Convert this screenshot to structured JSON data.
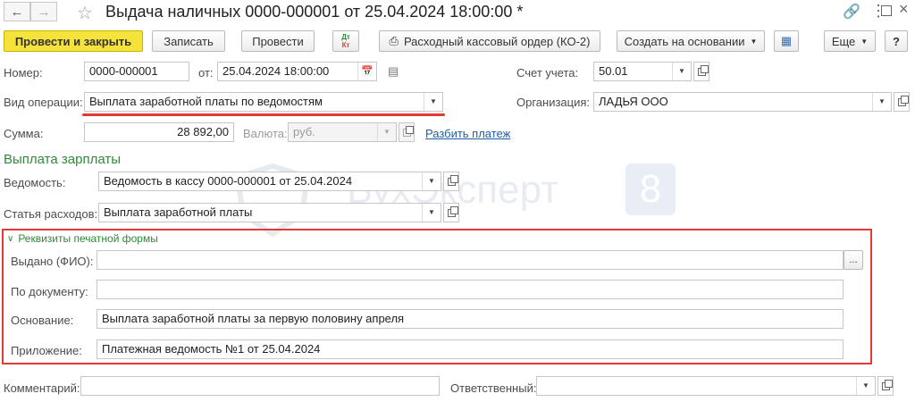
{
  "window": {
    "title": "Выдача наличных 0000-000001 от 25.04.2024 18:00:00 *"
  },
  "toolbar": {
    "post_close": "Провести и закрыть",
    "save": "Записать",
    "post": "Провести",
    "dtkt_top": "Дт",
    "dtkt_bottom": "Кт",
    "print_order": "Расходный кассовый ордер (КО-2)",
    "create_based": "Создать на основании",
    "more": "Еще",
    "help": "?"
  },
  "header": {
    "number_label": "Номер:",
    "number": "0000-000001",
    "date_label": "от:",
    "date": "25.04.2024 18:00:00",
    "account_label": "Счет учета:",
    "account": "50.01",
    "operation_label": "Вид операции:",
    "operation": "Выплата заработной платы по ведомостям",
    "org_label": "Организация:",
    "org": "ЛАДЬЯ ООО",
    "sum_label": "Сумма:",
    "sum": "28 892,00",
    "currency_label": "Валюта:",
    "currency": "руб.",
    "split_link": "Разбить платеж"
  },
  "salary": {
    "title": "Выплата зарплаты",
    "statement_label": "Ведомость:",
    "statement": "Ведомость в кассу 0000-000001 от 25.04.2024",
    "expense_label": "Статья расходов:",
    "expense": "Выплата заработной платы"
  },
  "print_form": {
    "title": "Реквизиты печатной формы",
    "issued_label": "Выдано (ФИО):",
    "issued": "",
    "doc_label": "По документу:",
    "doc": "",
    "basis_label": "Основание:",
    "basis": "Выплата заработной платы за первую половину апреля",
    "attach_label": "Приложение:",
    "attach": "Платежная ведомость №1 от 25.04.2024",
    "ellipsis": "..."
  },
  "footer": {
    "comment_label": "Комментарий:",
    "comment": "",
    "responsible_label": "Ответственный:",
    "responsible": ""
  },
  "watermark": {
    "text": "БухЭксперт",
    "digit": "8"
  },
  "colors": {
    "accent_red": "#e53935",
    "green_title": "#2f8a3a",
    "primary_yellow": "#f5e23b",
    "link_blue": "#1f5ea8"
  }
}
